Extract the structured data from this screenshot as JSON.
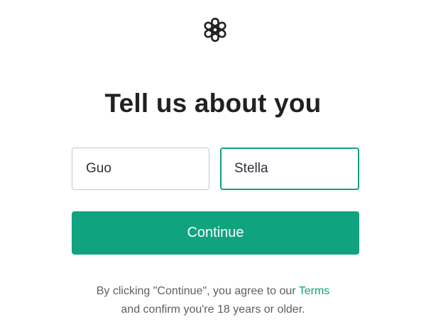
{
  "header": {
    "logo_icon": "openai-logo-icon",
    "title": "Tell us about you"
  },
  "form": {
    "first_name_value": "Guo",
    "last_name_value": "Stella",
    "continue_label": "Continue"
  },
  "legal": {
    "line1_prefix": "By clicking \"Continue\", you agree to our ",
    "terms_link": "Terms",
    "line2": "and confirm you're 18 years or older."
  },
  "colors": {
    "accent": "#10a37f",
    "title_text": "#202123",
    "muted_text": "#5d5f64",
    "input_border": "#c2c8d0"
  }
}
